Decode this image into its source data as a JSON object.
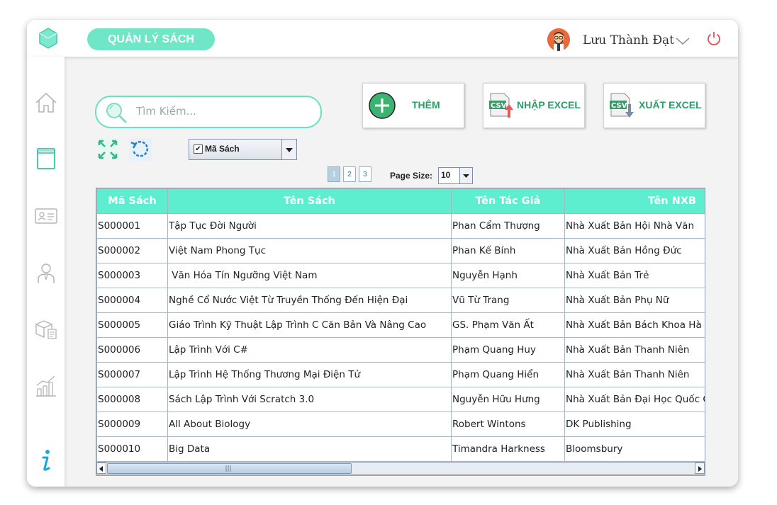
{
  "app": {
    "title": "QUẢN LÝ SÁCH",
    "user_name": "Lưu Thành Đạt",
    "accent_color": "#5deed0",
    "brand_color": "#6fe6c6"
  },
  "sidebar": {
    "items": [
      {
        "icon": "home-icon"
      },
      {
        "icon": "book-icon"
      },
      {
        "icon": "id-card-icon"
      },
      {
        "icon": "employee-icon"
      },
      {
        "icon": "package-icon"
      },
      {
        "icon": "statistics-icon"
      },
      {
        "icon": "info-icon"
      }
    ]
  },
  "search": {
    "placeholder": "Tìm Kiếm..."
  },
  "toolbar": {
    "add_label": "THÊM",
    "import_label": "NHẬP EXCEL",
    "export_label": "XUẤT EXCEL",
    "csv_text": "CSV"
  },
  "filter": {
    "selected": "Mã Sách",
    "checkmark": "✔"
  },
  "pagination": {
    "pages": [
      "1",
      "2",
      "3"
    ],
    "current": "1",
    "page_size_label": "Page Size:",
    "page_size": "10"
  },
  "table": {
    "columns": [
      "Mã Sách",
      "Tên Sách",
      "Tên Tác Giả",
      "Tên NXB"
    ],
    "rows": [
      [
        "S000001",
        "Tập Tục Đời Người",
        "Phan Cẩm Thượng",
        "Nhà Xuất Bản Hội Nhà Văn"
      ],
      [
        "S000002",
        "Việt Nam Phong Tục",
        "Phan Kế Bính",
        "Nhà Xuất Bản Hồng Đức"
      ],
      [
        "S000003",
        " Văn Hóa Tín Ngưỡng Việt Nam",
        "Nguyễn Hạnh",
        "Nhà Xuất Bản Trẻ"
      ],
      [
        "S000004",
        "Nghề Cổ Nước Việt Từ Truyền Thống Đến Hiện Đại",
        "Vũ Từ Trang",
        "Nhà Xuất Bản Phụ Nữ"
      ],
      [
        "S000005",
        "Giáo Trình Kỹ Thuật Lập Trình C Căn Bản Và Nâng Cao",
        "GS. Phạm Văn Ất",
        "Nhà Xuất Bản Bách Khoa Hà Nội"
      ],
      [
        "S000006",
        "Lập Trình Với C#",
        "Phạm Quang Huy",
        "Nhà Xuất Bản Thanh Niên"
      ],
      [
        "S000007",
        "Lập Trình Hệ Thống Thương Mại Điện Tử",
        "Phạm Quang Hiển",
        "Nhà Xuất Bản Thanh Niên"
      ],
      [
        "S000008",
        "Sách Lập Trình Với Scratch 3.0",
        "Nguyễn Hữu Hưng",
        "Nhà Xuất Bản Đại Học Quốc Gia"
      ],
      [
        "S000009",
        "All About Biology",
        "Robert Wintons",
        "DK Publishing"
      ],
      [
        "S000010",
        "Big Data",
        "Timandra Harkness",
        "Bloomsbury"
      ]
    ]
  }
}
